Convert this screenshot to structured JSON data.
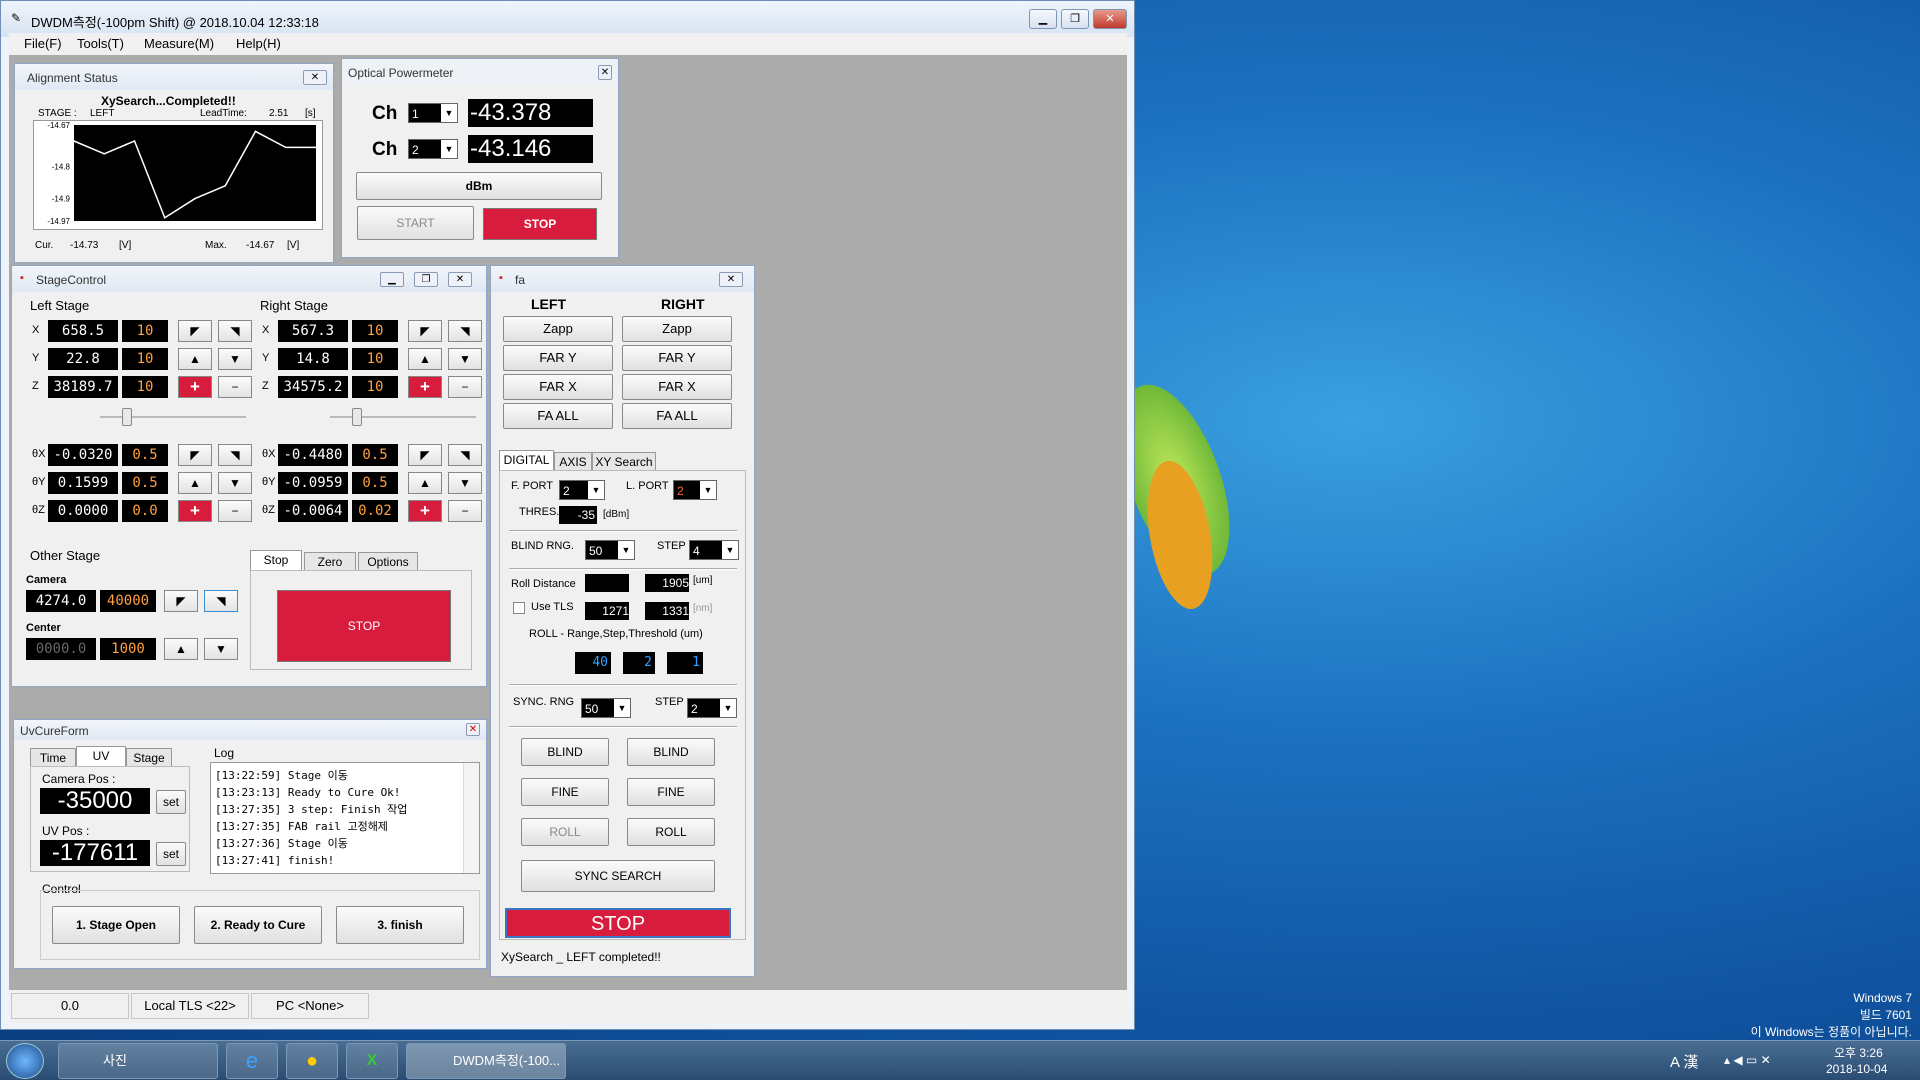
{
  "window": {
    "title": "DWDM측정(-100pm Shift) @ 2018.10.04 12:33:18"
  },
  "menu": [
    "File(F)",
    "Tools(T)",
    "Measure(M)",
    "Help(H)"
  ],
  "alignment": {
    "title": "Alignment Status",
    "status": "XySearch...Completed!!",
    "stage_label": "STAGE :",
    "stage": "LEFT",
    "leadtime_label": "LeadTime:",
    "leadtime": "2.51",
    "leadtime_unit": "[s]",
    "y_ticks": [
      "-14.67",
      "-14.8",
      "-14.9",
      "-14.97"
    ],
    "cur_label": "Cur.",
    "cur": "-14.73",
    "cur_unit": "[V]",
    "max_label": "Max.",
    "max": "-14.67",
    "max_unit": "[V]"
  },
  "chart_data": {
    "type": "line",
    "series": [
      {
        "values": [
          -14.72,
          -14.76,
          -14.72,
          -14.96,
          -14.9,
          -14.86,
          -14.69,
          -14.74,
          -14.74
        ]
      }
    ],
    "ylim": [
      -14.97,
      -14.67
    ],
    "y_ticks": [
      -14.67,
      -14.8,
      -14.9,
      -14.97
    ],
    "grid": false
  },
  "powermeter": {
    "title": "Optical Powermeter",
    "ch_label": "Ch",
    "ch1": "1",
    "ch1_value": "-43.378",
    "ch2": "2",
    "ch2_value": "-43.146",
    "unit": "dBm",
    "start": "START",
    "stop": "STOP"
  },
  "stage": {
    "title": "StageControl",
    "left_title": "Left Stage",
    "right_title": "Right Stage",
    "axes": [
      "X",
      "Y",
      "Z"
    ],
    "theta": [
      "θX",
      "θY",
      "θZ"
    ],
    "left": {
      "x": "658.5",
      "xs": "10",
      "y": "22.8",
      "ys": "10",
      "z": "38189.7",
      "zs": "10",
      "tx": "-0.0320",
      "txs": "0.5",
      "ty": "0.1599",
      "tys": "0.5",
      "tz": "0.0000",
      "tzs": "0.0"
    },
    "right": {
      "x": "567.3",
      "xs": "10",
      "y": "14.8",
      "ys": "10",
      "z": "34575.2",
      "zs": "10",
      "tx": "-0.4480",
      "txs": "0.5",
      "ty": "-0.0959",
      "tys": "0.5",
      "tz": "-0.0064",
      "tzs": "0.02"
    },
    "other_title": "Other Stage",
    "camera_label": "Camera",
    "camera": "4274.0",
    "camera_step": "40000",
    "center_label": "Center",
    "center": "0000.0",
    "center_step": "1000",
    "tabs": [
      "Stop",
      "Zero",
      "Options"
    ],
    "stop": "STOP"
  },
  "fa": {
    "title": "fa",
    "left": "LEFT",
    "right": "RIGHT",
    "buttons": [
      "Zapp",
      "FAR Y",
      "FAR X",
      "FA ALL"
    ],
    "tabs": [
      "DIGITAL",
      "AXIS",
      "XY Search"
    ],
    "fport_label": "F. PORT",
    "fport": "2",
    "lport_label": "L. PORT",
    "lport": "2",
    "thres_label": "THRES.",
    "thres": "-35",
    "thres_unit": "[dBm]",
    "blind_rng_label": "BLIND RNG.",
    "blind_rng": "50",
    "step_label": "STEP",
    "blind_step": "4",
    "roll_dist_label": "Roll Distance",
    "roll_dist": "1905",
    "um": "[um]",
    "use_tls": "Use TLS",
    "tls1": "1271",
    "tls2": "1331",
    "nm": "[nm]",
    "roll_label": "ROLL - Range,Step,Threshold (um)",
    "roll_range": "40",
    "roll_step": "2",
    "roll_thr": "1",
    "sync_rng_label": "SYNC. RNG",
    "sync_rng": "50",
    "sync_step": "2",
    "blind": "BLIND",
    "fine": "FINE",
    "roll": "ROLL",
    "sync_search": "SYNC SEARCH",
    "stop": "STOP",
    "status": "XySearch _ LEFT completed!!"
  },
  "uv": {
    "title": "UvCureForm",
    "tabs": [
      "Time",
      "UV",
      "Stage"
    ],
    "log_title": "Log",
    "camera_label": "Camera Pos :",
    "camera": "-35000",
    "uv_label": "UV Pos :",
    "uv": "-177611",
    "set": "set",
    "log": [
      "[13:22:59] Stage 이동",
      "[13:23:13] Ready to Cure Ok!",
      "[13:27:35] 3 step: Finish 작업",
      "[13:27:35] FAB rail 고정해제",
      "[13:27:36] Stage 이동",
      "[13:27:41] finish!"
    ],
    "control_label": "Control",
    "btn1": "1. Stage Open",
    "btn2": "2. Ready to Cure",
    "btn3": "3. finish"
  },
  "statusbar": [
    "0.0",
    "Local TLS <22>",
    "PC <None>"
  ],
  "desktop": {
    "wm1": "Windows 7",
    "wm2": "빌드 7601",
    "wm3": "이 Windows는 정품이 아닙니다."
  },
  "taskbar": {
    "photos": "사진",
    "app": "DWDM측정(-100...",
    "time": "오후 3:26",
    "date": "2018-10-04",
    "ime": "A 漢"
  }
}
